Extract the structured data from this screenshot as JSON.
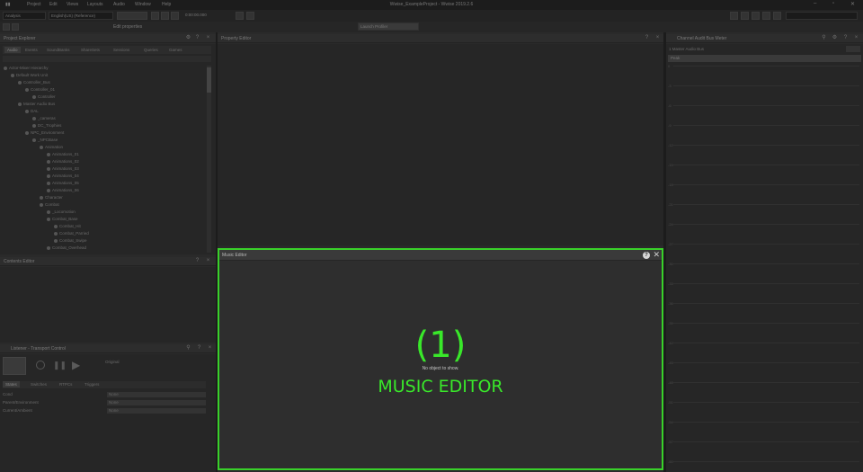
{
  "window": {
    "title": "Wwise_ExampleProject - Wwise 2019.2.6",
    "menu": [
      "Project",
      "Edit",
      "Views",
      "Layouts",
      "Audio",
      "Window",
      "Help"
    ]
  },
  "toolbar": {
    "layout_value": "Analysis",
    "platform_value": "English(US) (Reference)",
    "time_value": "0:00:00.000"
  },
  "sub_toolbar": {
    "item_label": "Edit properties",
    "button_label": "Launch Profiler"
  },
  "project_explorer": {
    "title": "Project Explorer",
    "tabs": [
      "Audio",
      "Events",
      "SoundBanks",
      "ShareSets",
      "Sessions",
      "Queries",
      "Games"
    ],
    "tree": [
      {
        "label": "Actor-Mixer Hierarchy",
        "depth": 0
      },
      {
        "label": "Default Work Unit",
        "depth": 1
      },
      {
        "label": "Controller_Bus",
        "depth": 2
      },
      {
        "label": "Controller_01",
        "depth": 3
      },
      {
        "label": "Controller",
        "depth": 4
      },
      {
        "label": "Master Audio Bus",
        "depth": 2
      },
      {
        "label": "DAL",
        "depth": 3
      },
      {
        "label": "_cameras",
        "depth": 4
      },
      {
        "label": "DC_Trophies",
        "depth": 4
      },
      {
        "label": "NPC_Environment",
        "depth": 3
      },
      {
        "label": "_NPCBase",
        "depth": 4
      },
      {
        "label": "Animation",
        "depth": 5
      },
      {
        "label": "Animations_01",
        "depth": 6
      },
      {
        "label": "Animations_02",
        "depth": 6
      },
      {
        "label": "Animations_03",
        "depth": 6
      },
      {
        "label": "Animations_04",
        "depth": 6
      },
      {
        "label": "Animations_05",
        "depth": 6
      },
      {
        "label": "Animations_06",
        "depth": 6
      },
      {
        "label": "Character",
        "depth": 5
      },
      {
        "label": "Combat",
        "depth": 5
      },
      {
        "label": "_Locomotion",
        "depth": 6
      },
      {
        "label": "Combat_Base",
        "depth": 6
      },
      {
        "label": "Combat_Hit",
        "depth": 7
      },
      {
        "label": "Combat_Parried",
        "depth": 7
      },
      {
        "label": "Combat_Swipe",
        "depth": 7
      },
      {
        "label": "Combat_Overhead",
        "depth": 6
      }
    ]
  },
  "contents_editor": {
    "title": "Contents Editor"
  },
  "transport": {
    "title": "Listener - Transport Control",
    "default_label": "Original",
    "tabs": [
      "States",
      "Switches",
      "RTPCs",
      "Triggers"
    ],
    "rows": [
      {
        "label": "Cond",
        "value": "None"
      },
      {
        "label": "Parent/Environment",
        "value": "None"
      },
      {
        "label": "Current/Ambient",
        "value": "None"
      }
    ]
  },
  "property_editor": {
    "title": "Property Editor"
  },
  "music_editor": {
    "title": "Music Editor",
    "empty_text": "No object to show.",
    "callout_number": "(1)",
    "callout_label": "MUSIC EDITOR",
    "highlight_color": "#39e82a"
  },
  "meter_panel": {
    "title": "Channel Audit Bus Meter",
    "subtitle": "1 Master Audio Bus",
    "dropdown_value": "Peak",
    "ticks": [
      "0",
      "-3",
      "-6",
      "-9",
      "-12",
      "-15",
      "-18",
      "-21",
      "-24",
      "-27",
      "-30",
      "-33",
      "-36",
      "-39",
      "-42",
      "-45",
      "-48",
      "-51",
      "-54",
      "-57",
      "-60"
    ]
  }
}
